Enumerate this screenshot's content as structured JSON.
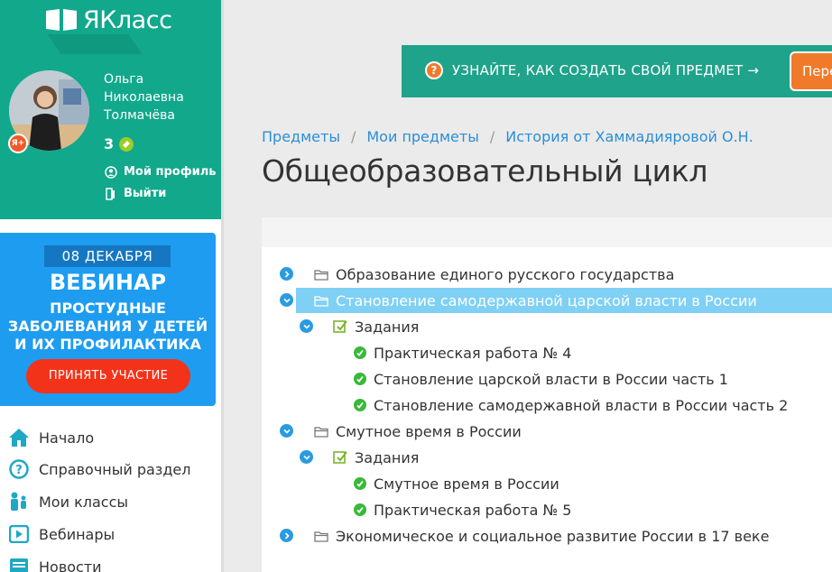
{
  "app": {
    "logo_text": "ЯКласс"
  },
  "user": {
    "name": "Ольга Николаевна Толмачёва",
    "points": "3",
    "badge": "Я+",
    "profile_label": "Мой профиль",
    "logout_label": "Выйти"
  },
  "webinar": {
    "date": "08 ДЕКАБРЯ",
    "title": "ВЕБИНАР",
    "subtitle": "ПРОСТУДНЫЕ ЗАБОЛЕВАНИЯ У ДЕТЕЙ И ИХ ПРОФИЛАКТИКА",
    "button": "ПРИНЯТЬ УЧАСТИЕ"
  },
  "nav": [
    {
      "label": "Начало",
      "icon": "home-icon"
    },
    {
      "label": "Справочный раздел",
      "icon": "help-icon"
    },
    {
      "label": "Мои классы",
      "icon": "people-icon"
    },
    {
      "label": "Вебинары",
      "icon": "play-icon"
    },
    {
      "label": "Новости",
      "icon": "news-icon"
    }
  ],
  "cta": {
    "text": "УЗНАЙТЕ, КАК СОЗДАТЬ СВОЙ ПРЕДМЕТ →",
    "icon": "?",
    "button": "Пере"
  },
  "breadcrumb": [
    "Предметы",
    "Мои предметы",
    "История от Хаммадияровой О.Н."
  ],
  "page_title": "Общеобразовательный цикл",
  "tree": [
    {
      "label": "Образование единого русского государства",
      "kind": "topic",
      "state": "collapsed"
    },
    {
      "label": "Становление самодержавной царской власти в России",
      "kind": "topic",
      "state": "expanded",
      "selected": true
    },
    {
      "label": "Задания",
      "kind": "tasks",
      "state": "expanded"
    },
    {
      "label": "Практическая работа № 4",
      "kind": "item"
    },
    {
      "label": "Становление царской власти в России часть 1",
      "kind": "item"
    },
    {
      "label": "Становление самодержавной власти в России часть 2",
      "kind": "item"
    },
    {
      "label": "Смутное время в России",
      "kind": "topic",
      "state": "expanded"
    },
    {
      "label": "Задания",
      "kind": "tasks",
      "state": "expanded"
    },
    {
      "label": "Смутное время в России",
      "kind": "item"
    },
    {
      "label": "Практическая работа № 5",
      "kind": "item"
    },
    {
      "label": "Экономическое и социальное развитие России в 17 веке",
      "kind": "topic",
      "state": "collapsed"
    }
  ],
  "colors": {
    "brand_green": "#11a88c",
    "cta_green": "#1fa38b",
    "link_blue": "#2a8fd6",
    "selected_row": "#7fd0f5",
    "webinar_blue": "#1e9cf0",
    "webinar_button": "#f2331a",
    "check_green": "#3ab83a"
  }
}
